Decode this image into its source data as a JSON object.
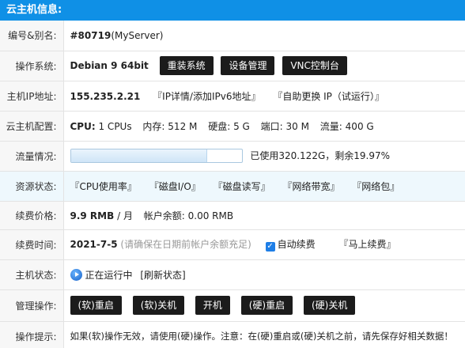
{
  "header": {
    "title": "云主机信息:"
  },
  "rows": {
    "id": {
      "label": "编号&别名:",
      "value": "#80719",
      "alias": "(MyServer)"
    },
    "os": {
      "label": "操作系统:",
      "value": "Debian 9 64bit",
      "buttons": [
        "重装系统",
        "设备管理",
        "VNC控制台"
      ]
    },
    "ip": {
      "label": "主机IP地址:",
      "value": "155.235.2.21",
      "links": [
        "『IP详情/添加IPv6地址』",
        "『自助更换 IP（试运行）』"
      ]
    },
    "config": {
      "label": "云主机配置:",
      "cpu_label": "CPU:",
      "cpu": "1 CPUs",
      "mem_label": "内存:",
      "mem": "512 M",
      "disk_label": "硬盘:",
      "disk": "5 G",
      "port_label": "端口:",
      "port": "30 M",
      "traffic_label": "流量:",
      "traffic": "400 G"
    },
    "traffic": {
      "label": "流量情况:",
      "used_fraction": 0.8,
      "text": "已使用320.122G，剩余19.97%"
    },
    "resources": {
      "label": "资源状态:",
      "links": [
        "『CPU使用率』",
        "『磁盘I/O』",
        "『磁盘读写』",
        "『网络带宽』",
        "『网络包』"
      ]
    },
    "price": {
      "label": "续费价格:",
      "value": "9.9 RMB",
      "unit": " / 月",
      "balance": "帐户余额: 0.00 RMB"
    },
    "renew": {
      "label": "续费时间:",
      "date": "2021-7-5",
      "hint": "(请确保在日期前帐户余额充足)",
      "auto_label": "自动续费",
      "renew_link": "『马上续费』"
    },
    "status": {
      "label": "主机状态:",
      "value": "正在运行中",
      "refresh": "[刷新状态]"
    },
    "manage": {
      "label": "管理操作:",
      "buttons": [
        "(软)重启",
        "(软)关机",
        "开机",
        "(硬)重启",
        "(硬)关机"
      ]
    },
    "tip": {
      "label": "操作提示:",
      "text": "如果(软)操作无效，请使用(硬)操作。注意：在(硬)重启或(硬)关机之前，请先保存好相关数据！"
    }
  },
  "colors": {
    "header": "#0f90e6",
    "button": "#1b1b1b",
    "warning_label": "#e02020",
    "highlight_row": "#eef8fd"
  }
}
